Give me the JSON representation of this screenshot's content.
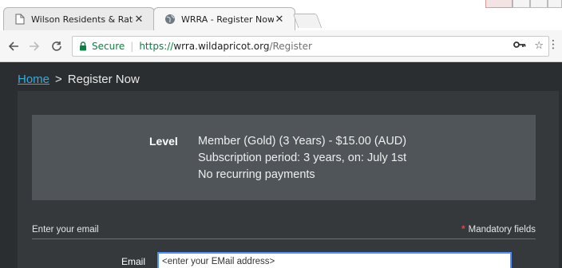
{
  "browser": {
    "tabs": [
      {
        "label": "Wilson Residents & Rate",
        "icon": "page-icon",
        "active": false
      },
      {
        "label": "WRRA - Register Now",
        "icon": "globe-icon",
        "active": true
      }
    ],
    "address_bar": {
      "secure_label": "Secure",
      "url_scheme": "https://",
      "url_host": "wrra.wildapricot.org",
      "url_path": "/Register"
    },
    "colors": {
      "secure": "#0b8043",
      "focus": "#4d90fe"
    }
  },
  "breadcrumb": {
    "home": "Home",
    "separator": ">",
    "current": "Register Now"
  },
  "level": {
    "label": "Level",
    "lines": [
      "Member (Gold) (3 Years) - $15.00 (AUD)",
      "Subscription period: 3 years, on: July 1st",
      "No recurring payments"
    ]
  },
  "email_section": {
    "title": "Enter your email",
    "required_marker": "*",
    "mandatory_note": "Mandatory fields",
    "email_label": "Email",
    "email_value": "<enter your EMail address>"
  },
  "colors": {
    "link": "#3aa8d8",
    "required": "#e2483d",
    "page_bg": "#2b2e31",
    "panel_bg": "#4f5558"
  }
}
